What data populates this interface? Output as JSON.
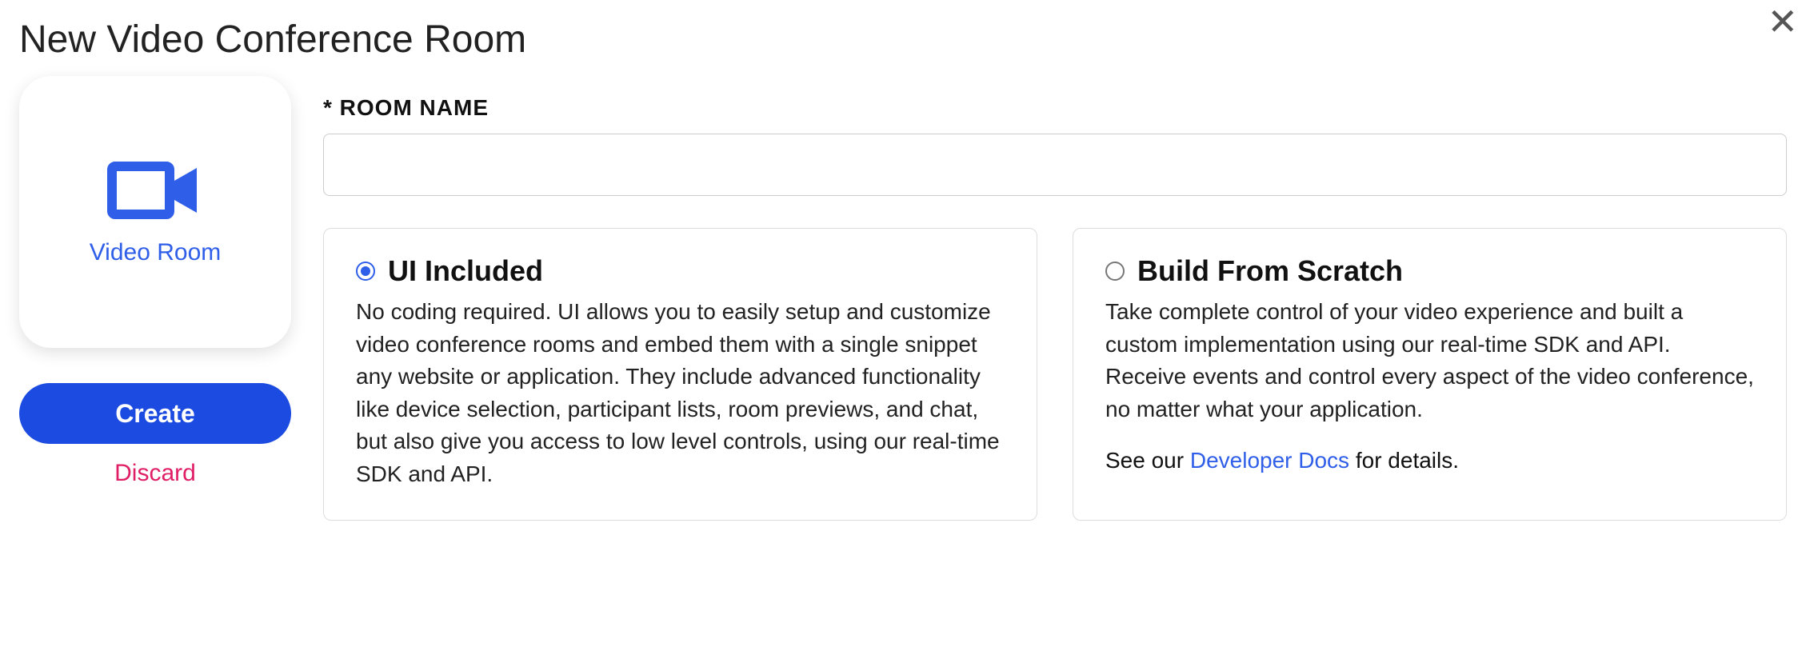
{
  "dialog": {
    "title": "New Video Conference Room"
  },
  "sidebar": {
    "card_label": "Video Room",
    "create_label": "Create",
    "discard_label": "Discard"
  },
  "form": {
    "room_name_label": "* ROOM NAME",
    "room_name_value": ""
  },
  "options": [
    {
      "title": "UI Included",
      "selected": true,
      "description": "No coding required. UI allows you to easily setup and customize video conference rooms and embed them with a single snippet any website or application. They include advanced functionality like device selection, participant lists, room previews, and chat, but also give you access to low level controls, using our real-time SDK and API."
    },
    {
      "title": "Build From Scratch",
      "selected": false,
      "description": "Take complete control of your video experience and built a custom implementation using our real-time SDK and API. Receive events and control every aspect of the video conference, no matter what your application.",
      "extra_prefix": "See our ",
      "extra_link": "Developer Docs",
      "extra_suffix": " for details."
    }
  ]
}
